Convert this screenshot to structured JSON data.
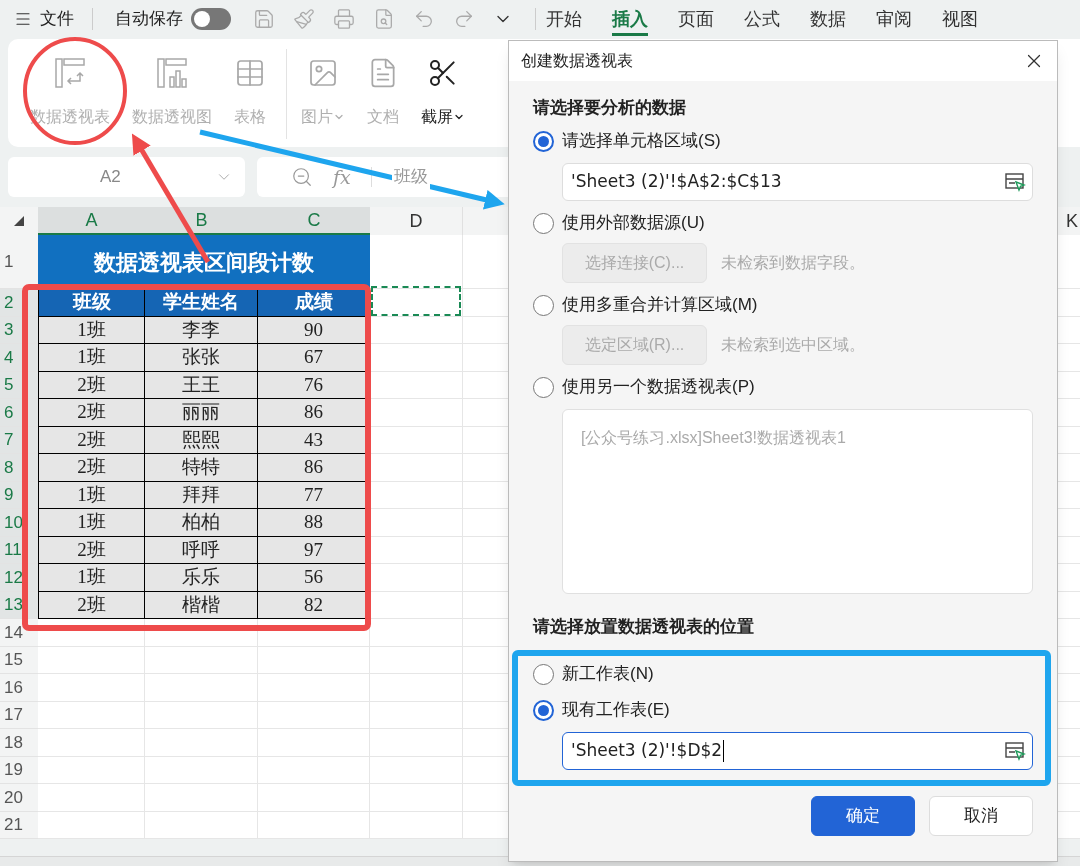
{
  "top_bar": {
    "file_menu": "文件",
    "autosave": {
      "label": "自动保存",
      "on": false
    },
    "tabs": [
      {
        "label": "开始",
        "selected": false
      },
      {
        "label": "插入",
        "selected": true
      },
      {
        "label": "页面",
        "selected": false
      },
      {
        "label": "公式",
        "selected": false
      },
      {
        "label": "数据",
        "selected": false
      },
      {
        "label": "审阅",
        "selected": false
      },
      {
        "label": "视图",
        "selected": false
      }
    ]
  },
  "ribbon": {
    "buttons": [
      {
        "kind": "pivot",
        "label": "数据透视表",
        "disabled": true,
        "dropdown": false
      },
      {
        "kind": "pivot_chart",
        "label": "数据透视图",
        "disabled": true,
        "dropdown": false
      },
      {
        "kind": "table",
        "label": "表格",
        "disabled": true,
        "dropdown": false
      },
      {
        "kind": "image",
        "label": "图片",
        "disabled": true,
        "dropdown": true
      },
      {
        "kind": "document",
        "label": "文档",
        "disabled": true,
        "dropdown": false
      },
      {
        "kind": "screenshot",
        "label": "截屏",
        "disabled": false,
        "dropdown": true
      }
    ]
  },
  "name_box": "A2",
  "formula_bar": {
    "fx": "fx",
    "value": "班级"
  },
  "sheet": {
    "columns": [
      {
        "label": "A",
        "selected": true
      },
      {
        "label": "B",
        "selected": true
      },
      {
        "label": "C",
        "selected": true
      },
      {
        "label": "D",
        "selected": false
      }
    ],
    "edge_column": "K",
    "rows": [
      {
        "label": "1",
        "selected": false
      },
      {
        "label": "2",
        "selected": true
      },
      {
        "label": "3",
        "selected": true
      },
      {
        "label": "4",
        "selected": true
      },
      {
        "label": "5",
        "selected": true
      },
      {
        "label": "6",
        "selected": true
      },
      {
        "label": "7",
        "selected": true
      },
      {
        "label": "8",
        "selected": true
      },
      {
        "label": "9",
        "selected": true
      },
      {
        "label": "10",
        "selected": true
      },
      {
        "label": "11",
        "selected": true
      },
      {
        "label": "12",
        "selected": true
      },
      {
        "label": "13",
        "selected": true
      },
      {
        "label": "14",
        "selected": false
      },
      {
        "label": "15",
        "selected": false
      },
      {
        "label": "16",
        "selected": false
      },
      {
        "label": "17",
        "selected": false
      },
      {
        "label": "18",
        "selected": false
      },
      {
        "label": "19",
        "selected": false
      },
      {
        "label": "20",
        "selected": false
      },
      {
        "label": "21",
        "selected": false
      }
    ],
    "title": "数据透视表区间段计数",
    "header": [
      "班级",
      "学生姓名",
      "成绩"
    ],
    "data": [
      [
        "1班",
        "李李",
        "90"
      ],
      [
        "1班",
        "张张",
        "67"
      ],
      [
        "2班",
        "王王",
        "76"
      ],
      [
        "2班",
        "丽丽",
        "86"
      ],
      [
        "2班",
        "熙熙",
        "43"
      ],
      [
        "2班",
        "特特",
        "86"
      ],
      [
        "1班",
        "拜拜",
        "77"
      ],
      [
        "1班",
        "柏柏",
        "88"
      ],
      [
        "2班",
        "呼呼",
        "97"
      ],
      [
        "1班",
        "乐乐",
        "56"
      ],
      [
        "2班",
        "楷楷",
        "82"
      ]
    ]
  },
  "dialog": {
    "title": "创建数据透视表",
    "source_heading": "请选择要分析的数据",
    "source_options": [
      {
        "label": "请选择单元格区域(S)",
        "selected": true,
        "field": "'Sheet3 (2)'!$A$2:$C$13"
      },
      {
        "label": "使用外部数据源(U)",
        "selected": false,
        "button": "选择连接(C)...",
        "note": "未检索到数据字段。"
      },
      {
        "label": "使用多重合并计算区域(M)",
        "selected": false,
        "button": "选定区域(R)...",
        "note": "未检索到选中区域。"
      },
      {
        "label": "使用另一个数据透视表(P)",
        "selected": false,
        "list_item": "[公众号练习.xlsx]Sheet3!数据透视表1"
      }
    ],
    "target_heading": "请选择放置数据透视表的位置",
    "target_options": [
      {
        "label": "新工作表(N)",
        "selected": false
      },
      {
        "label": "现有工作表(E)",
        "selected": true,
        "field": "'Sheet3 (2)'!$D$2"
      }
    ],
    "buttons": [
      {
        "label": "确定",
        "kind": "primary"
      },
      {
        "label": "取消",
        "kind": "secondary"
      }
    ]
  }
}
